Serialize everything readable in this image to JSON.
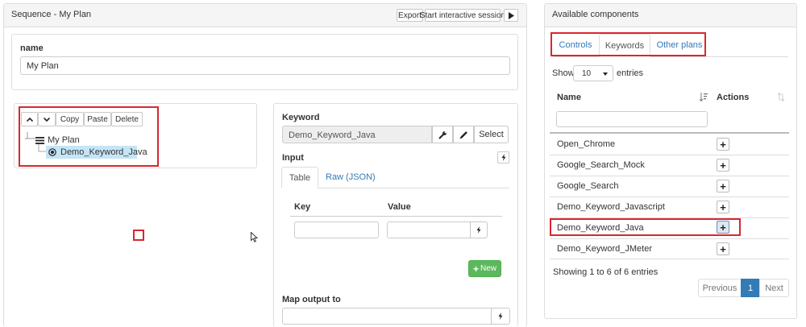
{
  "sequence": {
    "title": "Sequence - My Plan",
    "export_label": "Export",
    "start_session_label": "Start interactive session",
    "run_icon": "play-icon"
  },
  "plan_name": {
    "label": "name",
    "value": "My Plan"
  },
  "tree_toolbar": {
    "up_icon": "chevron-up-icon",
    "down_icon": "chevron-down-icon",
    "copy_label": "Copy",
    "paste_label": "Paste",
    "delete_label": "Delete"
  },
  "tree": {
    "root_label": "My Plan",
    "child_label": "Demo_Keyword_Java",
    "selected_color": "#c5e5f7"
  },
  "keyword": {
    "label": "Keyword",
    "value": "Demo_Keyword_Java",
    "select_label": "Select"
  },
  "input_section": {
    "label": "Input",
    "tabs": [
      "Table",
      "Raw (JSON)"
    ],
    "active_tab": "Table",
    "columns": [
      "Key",
      "Value"
    ],
    "new_label": "New",
    "new_button_color": "#5cb85c"
  },
  "map_output": {
    "label": "Map output to"
  },
  "components": {
    "title": "Available components",
    "tabs": [
      "Controls",
      "Keywords",
      "Other plans"
    ],
    "active_tab": "Keywords",
    "show_label": "Show",
    "entries_value": "10",
    "entries_label": "entries",
    "columns": [
      "Name",
      "Actions"
    ],
    "rows": [
      "Open_Chrome",
      "Google_Search_Mock",
      "Google_Search",
      "Demo_Keyword_Javascript",
      "Demo_Keyword_Java",
      "Demo_Keyword_JMeter"
    ],
    "info": "Showing 1 to 6 of 6 entries",
    "pagination": {
      "previous": "Previous",
      "current": "1",
      "next": "Next"
    },
    "accent_color": "#337ab7"
  },
  "highlight_color": "#d9272e"
}
